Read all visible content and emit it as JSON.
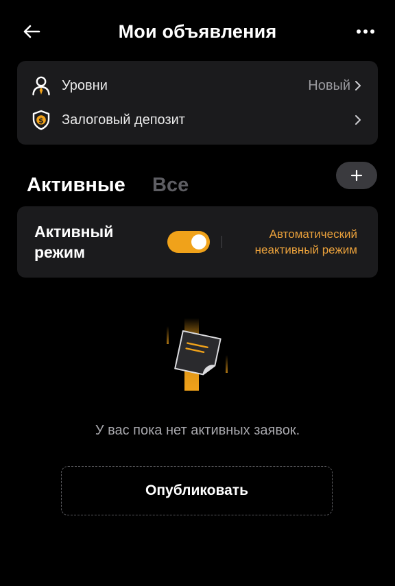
{
  "header": {
    "title": "Мои объявления",
    "back_icon": "arrow-left-icon",
    "more_icon": "more-horizontal-icon"
  },
  "settings": {
    "levels": {
      "label": "Уровни",
      "value": "Новый",
      "icon": "user-badge-icon"
    },
    "deposit": {
      "label": "Залоговый депозит",
      "icon": "shield-dollar-icon"
    }
  },
  "tabs": [
    {
      "label": "Активные",
      "active": true
    },
    {
      "label": "Все",
      "active": false
    }
  ],
  "add_button": {
    "icon": "plus-icon"
  },
  "mode": {
    "label": "Активный режим",
    "toggle_on": true,
    "auto_label": "Автоматический неактивный режим"
  },
  "empty_state": {
    "illustration": "sticky-note-icon",
    "message": "У вас пока нет активных заявок."
  },
  "publish_button": {
    "label": "Опубликовать"
  },
  "colors": {
    "background": "#000000",
    "card": "#1b1b1d",
    "accent": "#f0a21a",
    "accent_text": "#e9a03b",
    "muted_text": "#9a9a9f",
    "inactive_tab": "#5e5e63"
  }
}
